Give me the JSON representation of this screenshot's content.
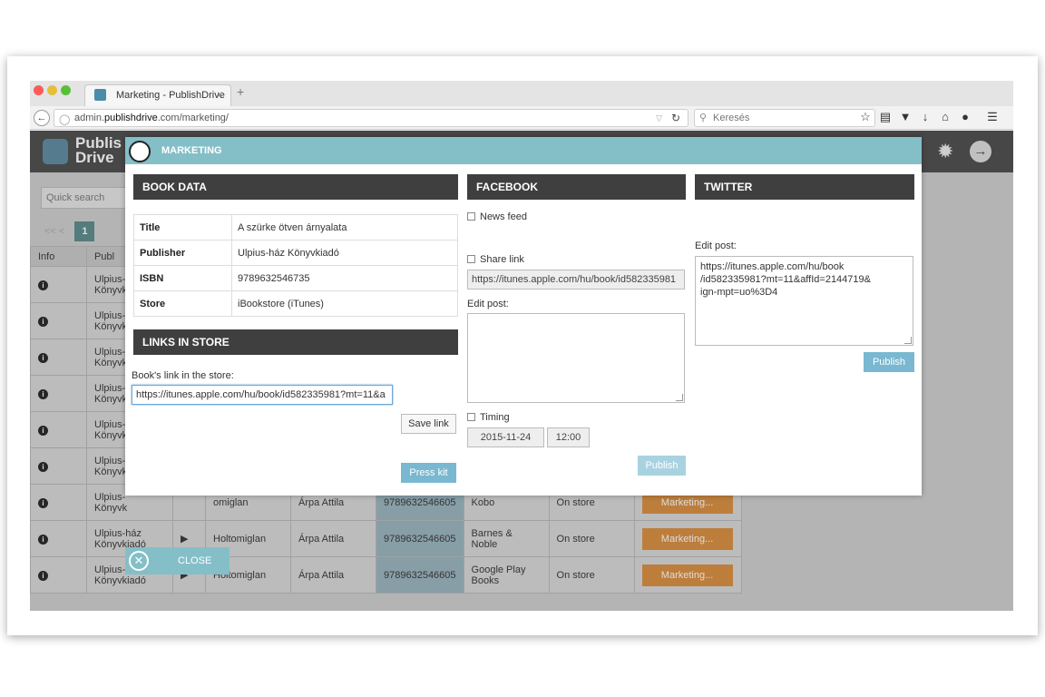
{
  "browser": {
    "tab_title": "Marketing - PublishDrive",
    "tab_close": "×",
    "new_tab": "+",
    "url_host_prefix": "admin.",
    "url_host_bold": "publishdrive",
    "url_rest": ".com/marketing/",
    "search_placeholder": "Keresés",
    "light_colors": [
      "#fc5b57",
      "#e5bf3c",
      "#57c038"
    ]
  },
  "app": {
    "logo_line1": "Publis",
    "logo_line2": "Drive",
    "quick_search": "Quick search",
    "pager_prev": "<<  <",
    "pager_page": "1",
    "table_headers": [
      "Info",
      "Publ"
    ],
    "rows": [
      {
        "pub1": "Ulpius-",
        "pub2": "Könyvk"
      },
      {
        "pub1": "Ulpius-",
        "pub2": "Könyvk"
      },
      {
        "pub1": "Ulpius-",
        "pub2": "Könyvk"
      },
      {
        "pub1": "Ulpius-",
        "pub2": "Könyvk"
      },
      {
        "pub1": "Ulpius-",
        "pub2": "Könyvk"
      },
      {
        "pub1": "Ulpius-",
        "pub2": "Könyvk"
      },
      {
        "pub1": "Ulpius-",
        "pub2": "Könyvk",
        "title": "omiglan",
        "author": "Árpa Attila",
        "isbn": "9789632546605",
        "store": "Kobo",
        "status": "On store",
        "btn": "Marketing..."
      },
      {
        "pub1": "Ulpius-ház",
        "pub2": "Könyvkiadó",
        "play": "▶",
        "title": "Holtomiglan",
        "author": "Árpa Attila",
        "isbn": "9789632546605",
        "store": "Barnes & Noble",
        "status": "On store",
        "btn": "Marketing..."
      },
      {
        "pub1": "Ulpius-ház",
        "pub2": "Könyvkiadó",
        "play": "▶",
        "title": "Holtomiglan",
        "author": "Árpa Attila",
        "isbn": "9789632546605",
        "store": "Google Play Books",
        "status": "On store",
        "btn": "Marketing..."
      }
    ]
  },
  "modal": {
    "title": "MARKETING",
    "book_data": {
      "heading": "BOOK DATA",
      "rows": [
        {
          "k": "Title",
          "v": "A szürke ötven árnyalata"
        },
        {
          "k": "Publisher",
          "v": "Ulpius-ház Könyvkiadó"
        },
        {
          "k": "ISBN",
          "v": "9789632546735"
        },
        {
          "k": "Store",
          "v": "iBookstore (iTunes)"
        }
      ]
    },
    "links": {
      "heading": "LINKS IN STORE",
      "label": "Book's link in the store:",
      "value": "https://itunes.apple.com/hu/book/id582335981?mt=11&a",
      "save": "Save link",
      "press": "Press kit"
    },
    "facebook": {
      "heading": "FACEBOOK",
      "news_feed": "News feed",
      "share_link": "Share link",
      "share_value": "https://itunes.apple.com/hu/book/id582335981",
      "edit_label": "Edit post:",
      "edit_value": "",
      "timing": "Timing",
      "date": "2015-11-24",
      "time": "12:00",
      "publish": "Publish"
    },
    "twitter": {
      "heading": "TWITTER",
      "edit_label": "Edit post:",
      "edit_value": "https://itunes.apple.com/hu/book\n/id582335981?mt=11&affId=2144719&\nign-mpt=uo%3D4",
      "publish": "Publish"
    },
    "close": "CLOSE"
  }
}
